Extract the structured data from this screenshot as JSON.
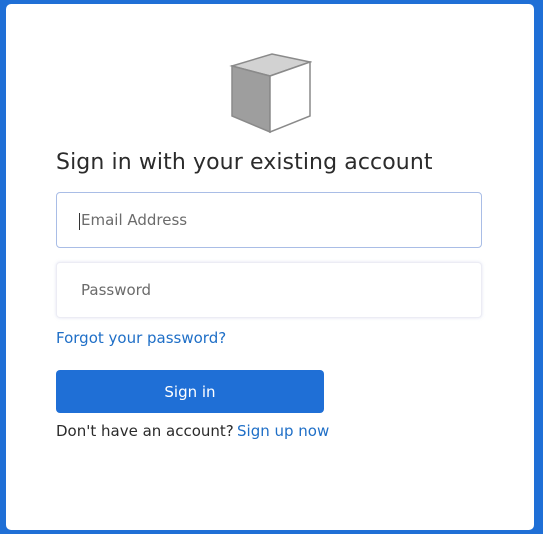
{
  "logo": {
    "icon": "cube-icon"
  },
  "form": {
    "heading": "Sign in with your existing account",
    "email_placeholder": "Email Address",
    "email_value": "",
    "password_placeholder": "Password",
    "password_value": "",
    "forgot_link": "Forgot your password?",
    "signin_label": "Sign in",
    "no_account_text": "Don't have an account?",
    "signup_link": "Sign up now"
  },
  "colors": {
    "page_background": "#1f6fd6",
    "button": "#1f6fd6",
    "link": "#1f6fc7"
  }
}
